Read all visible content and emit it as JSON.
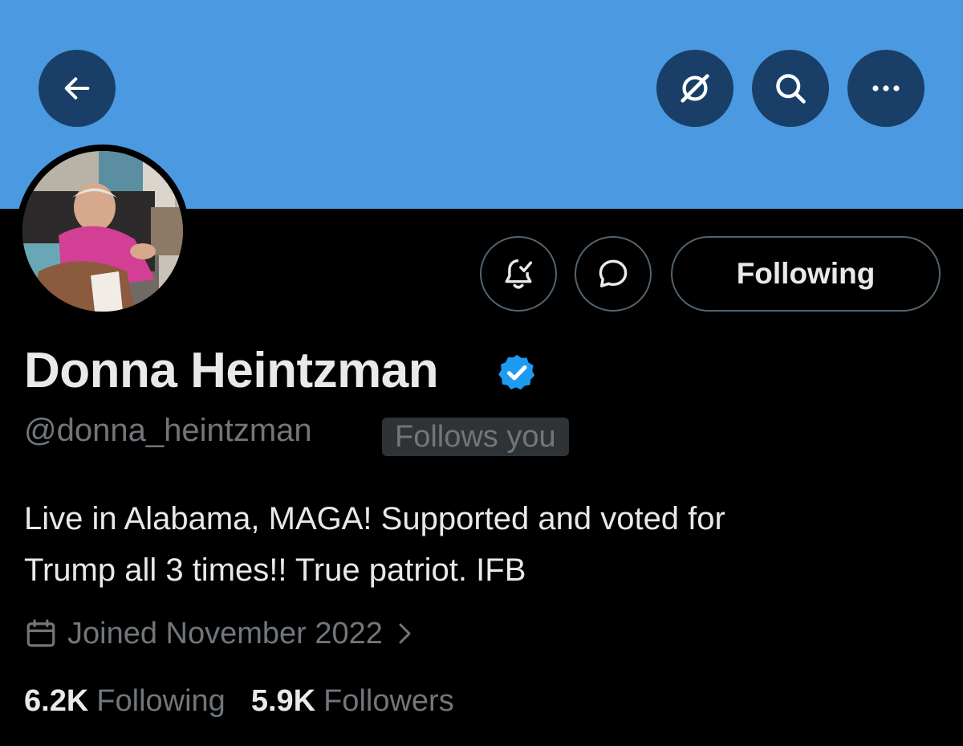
{
  "header": {
    "banner_color": "#4a99e1",
    "back_icon": "arrow-left-icon",
    "grok_icon": "grok-icon",
    "search_icon": "search-icon",
    "more_icon": "more-horizontal-icon"
  },
  "profile": {
    "display_name": "Donna Heintzman",
    "verified": true,
    "handle": "@donna_heintzman",
    "follows_you_badge": "Follows you",
    "bio_lines": [
      "Live in Alabama, MAGA! Supported and voted for",
      "Trump all 3 times!! True patriot. IFB"
    ],
    "joined": "Joined November 2022"
  },
  "actions": {
    "notifications_icon": "bell-check-icon",
    "message_icon": "message-bubble-icon",
    "follow_button_label": "Following"
  },
  "stats": {
    "following_count": "6.2K",
    "following_label": "Following",
    "followers_count": "5.9K",
    "followers_label": "Followers"
  },
  "colors": {
    "accent": "#1d9bf0",
    "text_primary": "#e7e9ea",
    "text_secondary": "#71767b",
    "background": "#000000"
  }
}
